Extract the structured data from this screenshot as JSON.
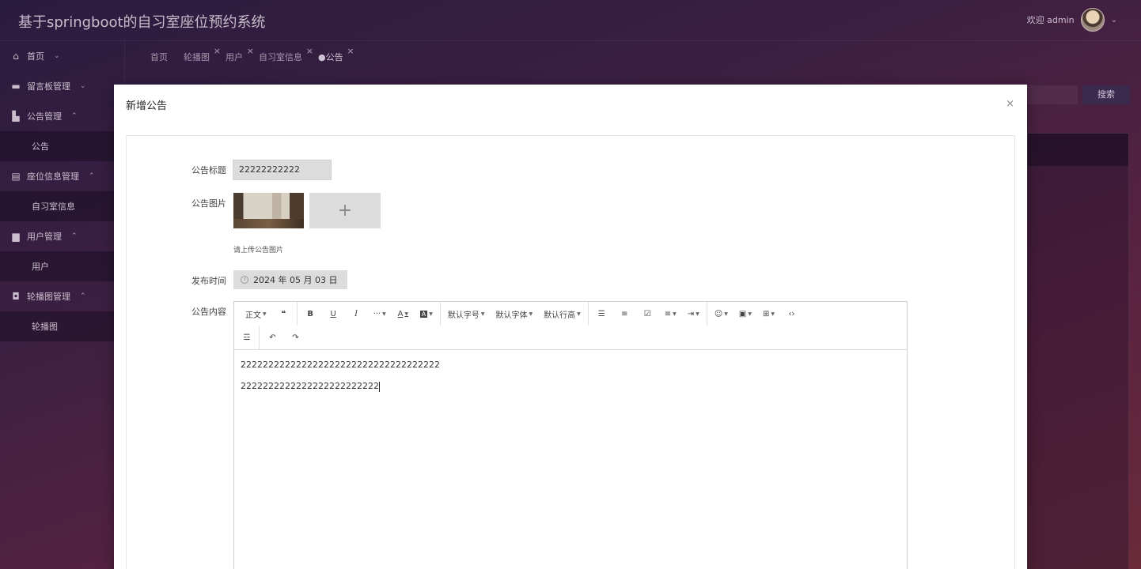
{
  "app": {
    "title": "基于springboot的自习室座位预约系统"
  },
  "user": {
    "welcome": "欢迎 admin"
  },
  "sidebar": {
    "items": [
      {
        "label": "首页",
        "icon": "home-icon",
        "caret": "⌄",
        "sub": false
      },
      {
        "label": "留言板管理",
        "icon": "board-icon",
        "caret": "⌄",
        "sub": false
      },
      {
        "label": "公告管理",
        "icon": "notice-icon",
        "caret": "⌃",
        "sub": false
      },
      {
        "label": "公告",
        "icon": "",
        "caret": "",
        "sub": true
      },
      {
        "label": "座位信息管理",
        "icon": "seat-icon",
        "caret": "⌃",
        "sub": false
      },
      {
        "label": "自习室信息",
        "icon": "",
        "caret": "",
        "sub": true
      },
      {
        "label": "用户管理",
        "icon": "user-icon",
        "caret": "⌃",
        "sub": false
      },
      {
        "label": "用户",
        "icon": "",
        "caret": "",
        "sub": true
      },
      {
        "label": "轮播图管理",
        "icon": "carousel-icon",
        "caret": "⌃",
        "sub": false
      },
      {
        "label": "轮播图",
        "icon": "",
        "caret": "",
        "sub": true
      }
    ]
  },
  "tabs": [
    {
      "label": "首页",
      "closable": false
    },
    {
      "label": "轮播图",
      "closable": true
    },
    {
      "label": "用户",
      "closable": true
    },
    {
      "label": "自习室信息",
      "closable": true
    },
    {
      "label": "●公告",
      "closable": true
    }
  ],
  "search": {
    "button": "搜索"
  },
  "modal": {
    "title": "新增公告",
    "close": "×",
    "fields": {
      "title_label": "公告标题",
      "title_value": "22222222222",
      "image_label": "公告图片",
      "image_hint": "请上传公告图片",
      "date_label": "发布时间",
      "date_value": "2024 年 05 月 03 日",
      "content_label": "公告内容"
    },
    "toolbar": {
      "row1": [
        "正文",
        "❝",
        "B",
        "U",
        "I",
        "···",
        "A",
        "A",
        "默认字号",
        "默认字体",
        "默认行高",
        "list",
        "olist",
        "todo",
        "align",
        "indent",
        "emoji",
        "image",
        "table",
        "code"
      ],
      "heading": "正文",
      "font_size": "默认字号",
      "font_family": "默认字体",
      "line_height": "默认行高"
    },
    "content": {
      "line1": "222222222222222222222222222222222222",
      "line2": "2222222222222222222222222"
    }
  }
}
